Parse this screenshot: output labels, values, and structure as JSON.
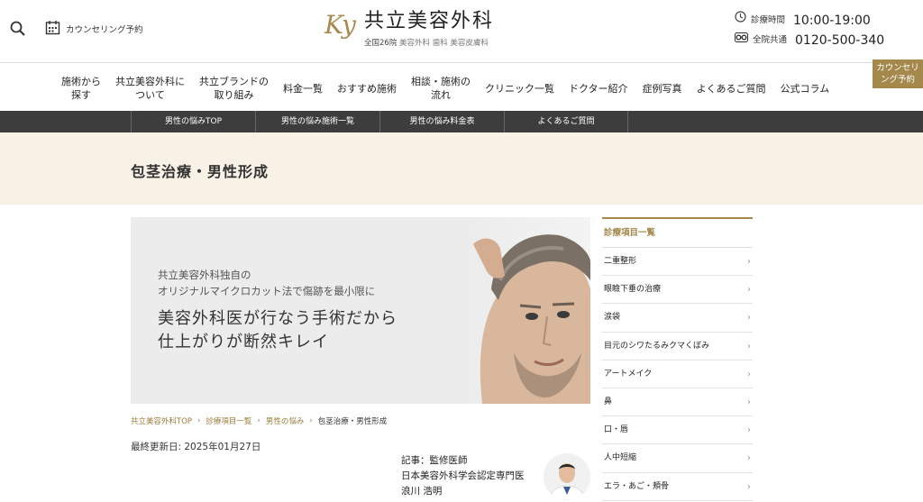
{
  "header": {
    "counsel_link": "カウンセリング予約",
    "logo_mark": "Ky",
    "logo_name": "共立美容外科",
    "logo_sub_count": "全国26院",
    "logo_sub_services": "美容外科 歯科 美容皮膚科",
    "hours_label": "診療時間",
    "hours_value": "10:00-19:00",
    "phone_label": "全院共通",
    "phone_value": "0120-500-340"
  },
  "gnav": {
    "items": [
      "施術から\n探す",
      "共立美容外科に\nついて",
      "共立ブランドの\n取り組み",
      "料金一覧",
      "おすすめ施術",
      "相談・施術の\n流れ",
      "クリニック一覧",
      "ドクター紹介",
      "症例写真",
      "よくあるご質問",
      "公式コラム"
    ],
    "cta": "カウンセリ\nング予約"
  },
  "subnav": {
    "items": [
      "男性の悩みTOP",
      "男性の悩み施術一覧",
      "男性の悩み料金表",
      "よくあるご質問"
    ]
  },
  "page": {
    "title": "包茎治療・男性形成"
  },
  "hero": {
    "sub_line1": "共立美容外科独自の",
    "sub_line2": "オリジナルマイクロカット法で傷跡を最小限に",
    "main_line1": "美容外科医が行なう手術だから",
    "main_line2": "仕上がりが断然キレイ"
  },
  "breadcrumb": {
    "items": [
      "共立美容外科TOP",
      "診療項目一覧",
      "男性の悩み",
      "包茎治療・男性形成"
    ]
  },
  "updated": "最終更新日:  2025年01月27日",
  "supervisor": {
    "line1": "記事：監修医師",
    "line2": "日本美容外科学会認定専門医",
    "line3": "浪川 浩明"
  },
  "sidebar": {
    "heading": "診療項目一覧",
    "items": [
      "二重整形",
      "眼瞼下垂の治療",
      "涙袋",
      "目元のシワたるみクマくぼみ",
      "アートメイク",
      "鼻",
      "口・唇",
      "人中短縮",
      "エラ・あご・頬骨"
    ]
  },
  "colors": {
    "accent": "#a4884c",
    "subnav_bg": "#3d3d3d",
    "title_band_bg": "#f8f1e6"
  }
}
